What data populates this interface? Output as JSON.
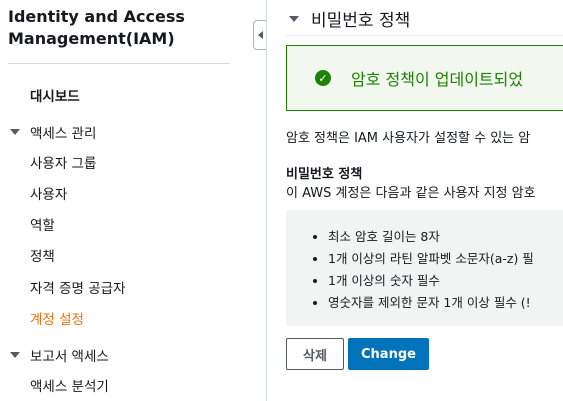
{
  "sidebar": {
    "title_line1": "Identity and Access",
    "title_line2": "Management(IAM)",
    "dashboard": "대시보드",
    "access_management": {
      "label": "액세스 관리",
      "items": [
        "사용자 그룹",
        "사용자",
        "역할",
        "정책",
        "자격 증명 공급자",
        "계정 설정"
      ],
      "active_index": 5
    },
    "reports": {
      "label": "보고서 액세스",
      "items": [
        "액세스 분석기"
      ]
    }
  },
  "main": {
    "panel_title": "비밀번호 정책",
    "alert_message": "암호 정책이 업데이트되었",
    "description": "암호 정책은 IAM 사용자가 설정할 수 있는 암",
    "policy_title": "비밀번호 정책",
    "policy_subtitle": "이 AWS 계정은 다음과 같은 사용자 지정 암호",
    "rules": [
      "최소 암호 길이는 8자",
      "1개 이상의 라틴 알파벳 소문자(a-z) 필",
      "1개 이상의 숫자 필수",
      "영숫자를 제외한 문자 1개 이상 필수 (!"
    ],
    "buttons": {
      "delete": "삭제",
      "change": "Change"
    }
  },
  "colors": {
    "accent_active": "#ec7211",
    "success": "#1d8102",
    "primary_button": "#0073bb"
  }
}
